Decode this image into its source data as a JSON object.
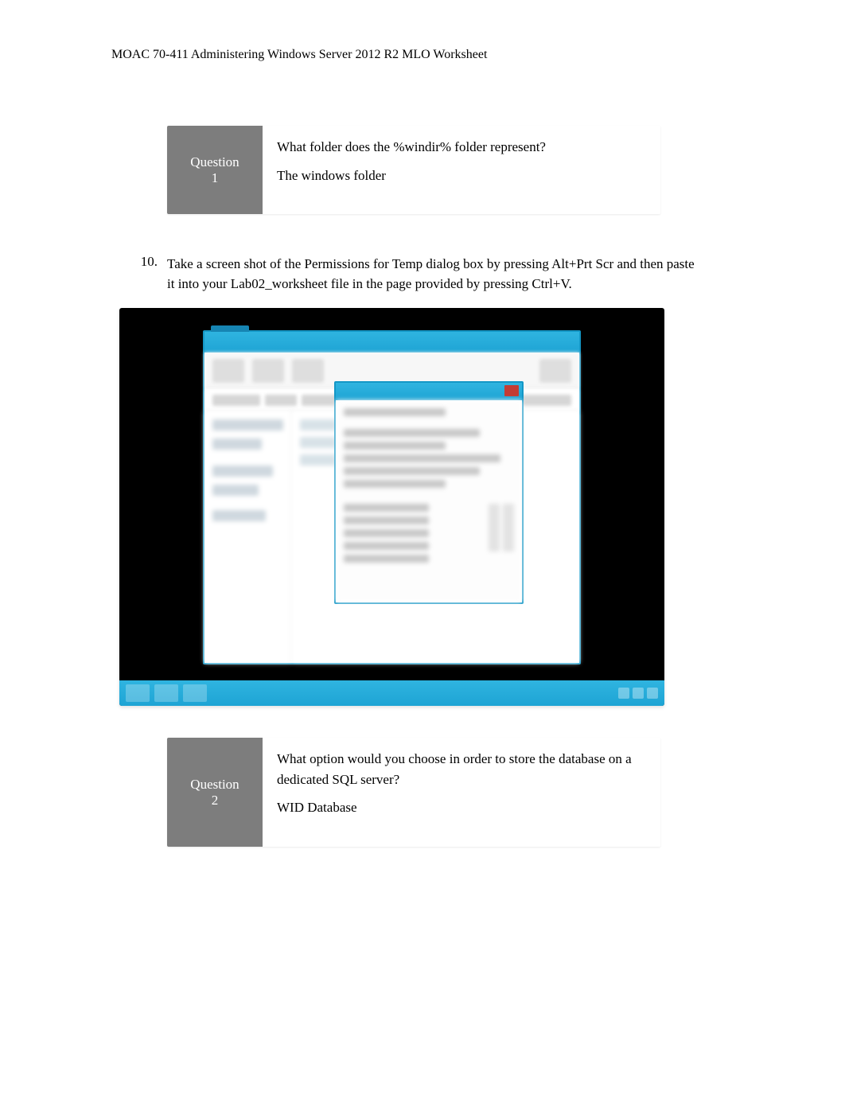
{
  "header": "MOAC 70-411 Administering Windows Server 2012 R2 MLO Worksheet",
  "q1": {
    "label_word": "Question",
    "label_num": "1",
    "prompt": "What folder does the %windir% folder represent?",
    "answer": "The windows folder"
  },
  "step10": {
    "number": "10.",
    "text": "Take a screen shot of the Permissions for Temp dialog box by pressing Alt+Prt Scr and then paste it into your Lab02_worksheet file in the page provided by pressing Ctrl+V."
  },
  "q2": {
    "label_word": "Question",
    "label_num": "2",
    "prompt": "What option would you choose in order to store the database on a dedicated SQL server?",
    "answer": "WID Database"
  }
}
